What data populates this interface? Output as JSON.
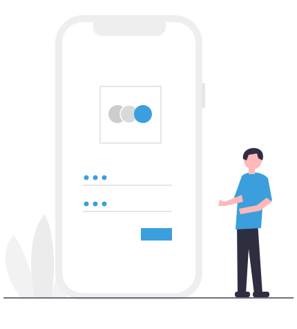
{
  "colors": {
    "phone_frame": "#eeeeee",
    "screen": "#ffffff",
    "card_border": "#dddddd",
    "accent": "#3a9fdc",
    "grey_circle": "#cccccc",
    "plant": "#f0f0f0",
    "line": "#e3e3e3",
    "shirt": "#3a9fdc",
    "pants": "#2f2e41",
    "skin": "#ffb8b8",
    "hair": "#2f2e41"
  },
  "login": {
    "username_masked": "•••",
    "password_masked": "•••",
    "submit_button_value": ""
  },
  "icons": {
    "logo": "three-overlapping-circles",
    "ground": "ground-line"
  }
}
